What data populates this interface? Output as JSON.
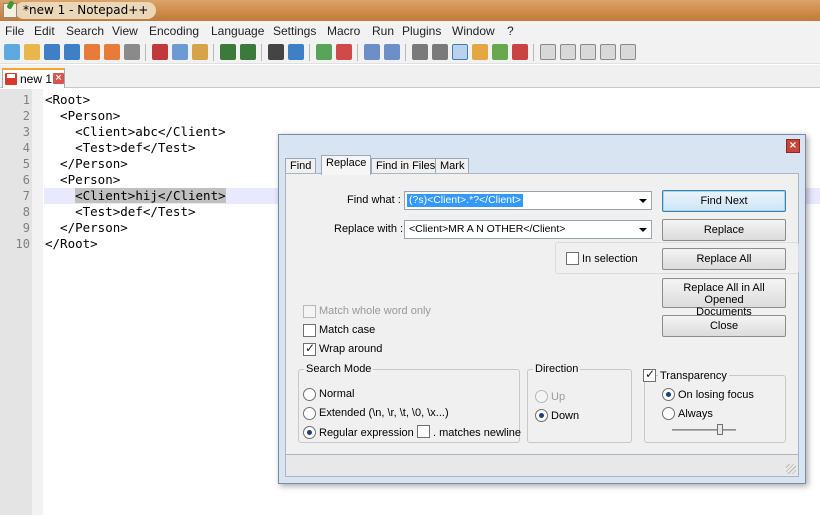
{
  "window": {
    "title": "*new 1 - Notepad++"
  },
  "menu": [
    "File",
    "Edit",
    "Search",
    "View",
    "Encoding",
    "Language",
    "Settings",
    "Macro",
    "Run",
    "Plugins",
    "Window",
    "?"
  ],
  "tab": {
    "label": "new 1",
    "close_glyph": "×"
  },
  "editor": {
    "line_numbers": [
      "1",
      "2",
      "3",
      "4",
      "5",
      "6",
      "7",
      "8",
      "9",
      "10"
    ],
    "lines": [
      "<Root>",
      "  <Person>",
      "    <Client>abc</Client>",
      "    <Test>def</Test>",
      "  </Person>",
      "  <Person>",
      "    ",
      "    <Test>def</Test>",
      "  </Person>",
      "</Root>"
    ],
    "selected_text": "<Client>hij</Client>",
    "current_line": 7
  },
  "dialog": {
    "close_glyph": "×",
    "tabs": [
      "Find",
      "Replace",
      "Find in Files",
      "Mark"
    ],
    "active_tab": "Replace",
    "find_what_label": "Find what :",
    "find_what_value": "(?s)<Client>.*?</Client>",
    "replace_with_label": "Replace with :",
    "replace_with_value": "<Client>MR A N OTHER</Client>",
    "in_selection_label": "In selection",
    "buttons": {
      "find_next": "Find Next",
      "replace": "Replace",
      "replace_all": "Replace All",
      "replace_all_opened_line1": "Replace All in All Opened",
      "replace_all_opened_line2": "Documents",
      "close": "Close"
    },
    "options": {
      "match_whole_word": {
        "label": "Match whole word only",
        "checked": false,
        "enabled": false
      },
      "match_case": {
        "label": "Match case",
        "checked": false,
        "enabled": true
      },
      "wrap_around": {
        "label": "Wrap around",
        "checked": true,
        "enabled": true
      }
    },
    "search_mode": {
      "title": "Search Mode",
      "normal": "Normal",
      "extended": "Extended (\\n, \\r, \\t, \\0, \\x...)",
      "regex": ". matches newline",
      "regex_label": "Regular expression",
      "selected": "Regular expression"
    },
    "direction": {
      "title": "Direction",
      "up": "Up",
      "down": "Down",
      "selected": "Down"
    },
    "transparency": {
      "title": "Transparency",
      "checked": true,
      "on_losing_focus": "On losing focus",
      "always": "Always",
      "selected": "On losing focus",
      "level": 0.75
    }
  },
  "colors": {
    "titlebar": "#cc8a47",
    "tab_accent": "#f3a530",
    "selection": "#3399ff",
    "current_line": "#e8e8ff"
  }
}
